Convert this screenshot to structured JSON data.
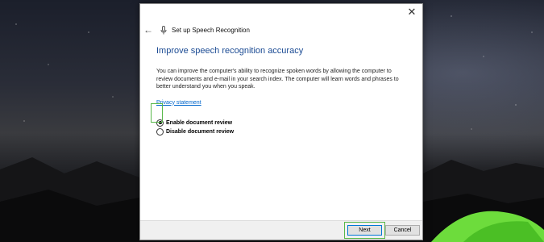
{
  "window": {
    "title": "Set up Speech Recognition",
    "close_glyph": "✕",
    "back_glyph": "←"
  },
  "main": {
    "heading": "Improve speech recognition accuracy",
    "description": "You can improve the computer's ability to recognize spoken words by allowing the computer to review documents and e-mail in your search index. The computer will learn words and phrases to better understand you when you speak.",
    "privacy_link": "Privacy statement",
    "options": [
      {
        "label": "Enable document review",
        "selected": true
      },
      {
        "label": "Disable document review",
        "selected": false
      }
    ]
  },
  "footer": {
    "next_label": "Next",
    "cancel_label": "Cancel"
  },
  "colors": {
    "heading": "#1a4a93",
    "link": "#0066cc",
    "focus_highlight": "#58b84a",
    "tent": "#6ddc3c"
  },
  "icons": [
    "close-icon",
    "back-arrow-icon",
    "microphone-icon"
  ]
}
